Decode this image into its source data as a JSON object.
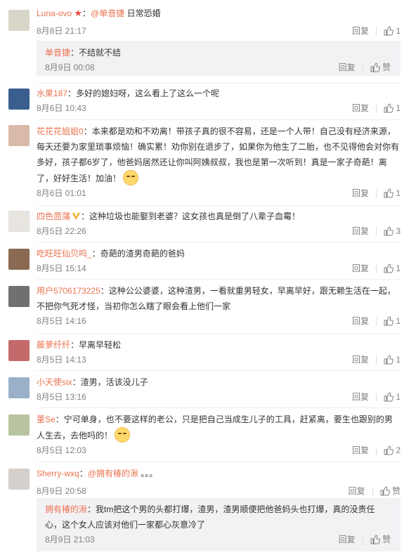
{
  "comments": [
    {
      "user": "Luna-ovo",
      "text_prefix": "：",
      "mention": "@单音捷",
      "text": " 日常恐婚",
      "date": "8月8日 21:17",
      "reply": "回复",
      "likes": "1",
      "avatar_color": "#d8d6c8",
      "sub": {
        "user": "单音捷",
        "text": "：不结就不结",
        "date": "8月9日 00:08",
        "reply": "回复",
        "likes": "赞"
      }
    },
    {
      "user": "水果187",
      "text": "：多好的媳妇呀，这么看上了这么一个呢",
      "date": "8月6日 10:43",
      "reply": "回复",
      "likes": "1",
      "avatar_color": "#3a5f8f"
    },
    {
      "user": "花花花姐姐0",
      "text": "：本来都是劝和不劝离！带孩子真的很不容易，还是一个人带！自己没有经济来源，每天还要为家里琐事烦恼！确实累！劝你别在退步了，如果你为他生了二胎，也不见得他会对你有多好，孩子都6岁了，他爸妈居然还让你叫阿姨叔叔，我也是第一次听到！真是一家子奇葩！离了，好好生活！加油！",
      "date": "8月6日 01:01",
      "reply": "回复",
      "likes": "1",
      "avatar_color": "#d9b9a8"
    },
    {
      "user": "四色茴蒲",
      "text": "：这种垃圾也能娶到老婆？这女孩也真是倒了八辈子血霉！",
      "date": "8月5日 22:26",
      "reply": "回复",
      "likes": "3",
      "avatar_color": "#e8e4e0"
    },
    {
      "user": "吃旺旺仙贝呜_",
      "text": "：奇葩的渣男奇葩的爸妈",
      "date": "8月5日 15:14",
      "reply": "回复",
      "likes": "1",
      "avatar_color": "#8a6a52"
    },
    {
      "user": "用户5706173225",
      "text": "：这种公公婆婆，这种渣男，一看就重男轻女，早离早好，跟无赖生活在一起，不把你气死才怪，当初你怎么瞎了眼会看上他们一家",
      "date": "8月5日 14:16",
      "reply": "回复",
      "likes": "1",
      "avatar_color": "#707070"
    },
    {
      "user": "藤萝纤纤",
      "text": "：早离早轻松",
      "date": "8月5日 14:13",
      "reply": "回复",
      "likes": "1",
      "avatar_color": "#c56a6a"
    },
    {
      "user": "小天使six",
      "text": "：渣男，活该没儿子",
      "date": "8月5日 13:16",
      "reply": "回复",
      "likes": "1",
      "avatar_color": "#9ab0c8"
    },
    {
      "user": "董Se",
      "text": "：宁可单身，也不要这样的老公，只是把自己当成生儿子的工具，赶紧离，要生也跟别的男人生去，去他吗的！",
      "date": "8月5日 12:03",
      "reply": "回复",
      "likes": "2",
      "avatar_color": "#b8c4a0"
    },
    {
      "user": "Sherry-wxq",
      "text_prefix": "：",
      "mention": "@拥有椿的湫",
      "text": " 。。。",
      "date": "8月9日 20:58",
      "reply": "回复",
      "likes": "赞",
      "avatar_color": "#d6d0cc",
      "sub": {
        "user": "拥有椿的湫",
        "text": "：我tm把这个男的头都打爆，渣男，渣男顺便把他爸妈头也打爆，真的没责任心，这个女人应该对他们一家都心灰意冷了",
        "date": "8月9日 21:03",
        "reply": "回复",
        "likes": "赞"
      }
    }
  ]
}
